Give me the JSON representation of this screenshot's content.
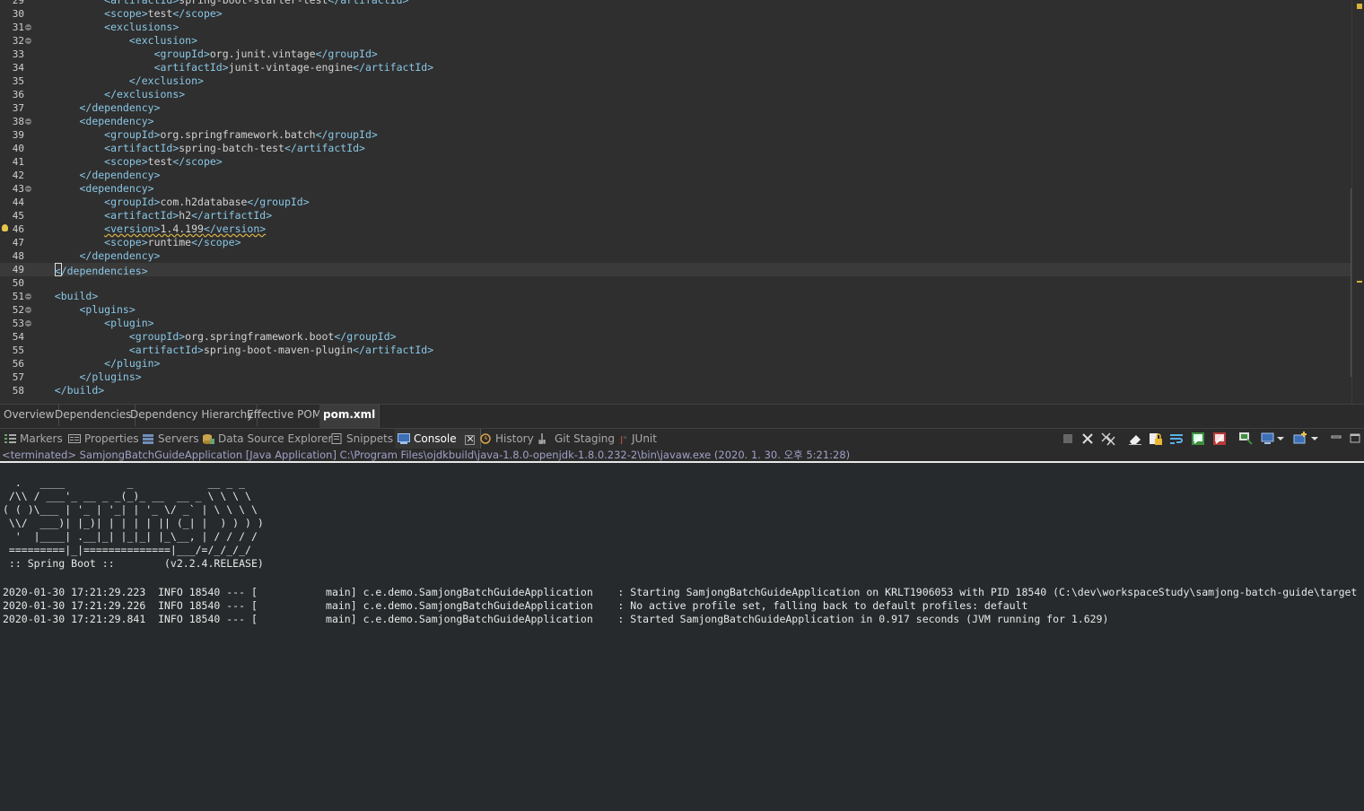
{
  "editor": {
    "lines": [
      {
        "n": "29",
        "fold": false,
        "bulb": false,
        "current": false,
        "indent": "        ",
        "open": "artifactId",
        "value": "spring-boot-starter-test",
        "close": "artifactId"
      },
      {
        "n": "30",
        "fold": false,
        "bulb": false,
        "current": false,
        "indent": "        ",
        "open": "scope",
        "value": "test",
        "close": "scope"
      },
      {
        "n": "31",
        "fold": true,
        "bulb": false,
        "current": false,
        "indent": "        ",
        "open": "exclusions",
        "value": "",
        "close": ""
      },
      {
        "n": "32",
        "fold": true,
        "bulb": false,
        "current": false,
        "indent": "            ",
        "open": "exclusion",
        "value": "",
        "close": ""
      },
      {
        "n": "33",
        "fold": false,
        "bulb": false,
        "current": false,
        "indent": "                ",
        "open": "groupId",
        "value": "org.junit.vintage",
        "close": "groupId"
      },
      {
        "n": "34",
        "fold": false,
        "bulb": false,
        "current": false,
        "indent": "                ",
        "open": "artifactId",
        "value": "junit-vintage-engine",
        "close": "artifactId"
      },
      {
        "n": "35",
        "fold": false,
        "bulb": false,
        "current": false,
        "indent": "            ",
        "open": "",
        "value": "",
        "close": "exclusion"
      },
      {
        "n": "36",
        "fold": false,
        "bulb": false,
        "current": false,
        "indent": "        ",
        "open": "",
        "value": "",
        "close": "exclusions"
      },
      {
        "n": "37",
        "fold": false,
        "bulb": false,
        "current": false,
        "indent": "    ",
        "open": "",
        "value": "",
        "close": "dependency"
      },
      {
        "n": "38",
        "fold": true,
        "bulb": false,
        "current": false,
        "indent": "    ",
        "open": "dependency",
        "value": "",
        "close": ""
      },
      {
        "n": "39",
        "fold": false,
        "bulb": false,
        "current": false,
        "indent": "        ",
        "open": "groupId",
        "value": "org.springframework.batch",
        "close": "groupId"
      },
      {
        "n": "40",
        "fold": false,
        "bulb": false,
        "current": false,
        "indent": "        ",
        "open": "artifactId",
        "value": "spring-batch-test",
        "close": "artifactId"
      },
      {
        "n": "41",
        "fold": false,
        "bulb": false,
        "current": false,
        "indent": "        ",
        "open": "scope",
        "value": "test",
        "close": "scope"
      },
      {
        "n": "42",
        "fold": false,
        "bulb": false,
        "current": false,
        "indent": "    ",
        "open": "",
        "value": "",
        "close": "dependency"
      },
      {
        "n": "43",
        "fold": true,
        "bulb": false,
        "current": false,
        "indent": "    ",
        "open": "dependency",
        "value": "",
        "close": ""
      },
      {
        "n": "44",
        "fold": false,
        "bulb": false,
        "current": false,
        "indent": "        ",
        "open": "groupId",
        "value": "com.h2database",
        "close": "groupId"
      },
      {
        "n": "45",
        "fold": false,
        "bulb": false,
        "current": false,
        "indent": "        ",
        "open": "artifactId",
        "value": "h2",
        "close": "artifactId"
      },
      {
        "n": "46",
        "fold": false,
        "bulb": true,
        "current": false,
        "warn": true,
        "indent": "        ",
        "open": "version",
        "value": "1.4.199",
        "close": "version"
      },
      {
        "n": "47",
        "fold": false,
        "bulb": false,
        "current": false,
        "indent": "        ",
        "open": "scope",
        "value": "runtime",
        "close": "scope"
      },
      {
        "n": "48",
        "fold": false,
        "bulb": false,
        "current": false,
        "indent": "    ",
        "open": "",
        "value": "",
        "close": "dependency"
      },
      {
        "n": "49",
        "fold": false,
        "bulb": false,
        "current": true,
        "caret": true,
        "indent": "",
        "open": "",
        "value": "",
        "close": "dependencies"
      },
      {
        "n": "50",
        "fold": false,
        "bulb": false,
        "current": false,
        "indent": "",
        "open": "",
        "value": "",
        "close": ""
      },
      {
        "n": "51",
        "fold": true,
        "bulb": false,
        "current": false,
        "indent": "",
        "open": "build",
        "value": "",
        "close": ""
      },
      {
        "n": "52",
        "fold": true,
        "bulb": false,
        "current": false,
        "indent": "    ",
        "open": "plugins",
        "value": "",
        "close": ""
      },
      {
        "n": "53",
        "fold": true,
        "bulb": false,
        "current": false,
        "indent": "        ",
        "open": "plugin",
        "value": "",
        "close": ""
      },
      {
        "n": "54",
        "fold": false,
        "bulb": false,
        "current": false,
        "indent": "            ",
        "open": "groupId",
        "value": "org.springframework.boot",
        "close": "groupId"
      },
      {
        "n": "55",
        "fold": false,
        "bulb": false,
        "current": false,
        "indent": "            ",
        "open": "artifactId",
        "value": "spring-boot-maven-plugin",
        "close": "artifactId"
      },
      {
        "n": "56",
        "fold": false,
        "bulb": false,
        "current": false,
        "indent": "        ",
        "open": "",
        "value": "",
        "close": "plugin"
      },
      {
        "n": "57",
        "fold": false,
        "bulb": false,
        "current": false,
        "indent": "    ",
        "open": "",
        "value": "",
        "close": "plugins"
      },
      {
        "n": "58",
        "fold": false,
        "bulb": false,
        "current": false,
        "indent": "",
        "open": "",
        "value": "",
        "close": "build"
      }
    ]
  },
  "pom_tabs": [
    "Overview",
    "Dependencies",
    "Dependency Hierarchy",
    "Effective POM",
    "pom.xml"
  ],
  "pom_active": "pom.xml",
  "view_tabs": [
    {
      "label": "Markers",
      "icon": "markers-icon"
    },
    {
      "label": "Properties",
      "icon": "properties-icon"
    },
    {
      "label": "Servers",
      "icon": "servers-icon"
    },
    {
      "label": "Data Source Explorer",
      "icon": "data-source-icon"
    },
    {
      "label": "Snippets",
      "icon": "snippets-icon"
    },
    {
      "label": "Console",
      "icon": "console-icon",
      "active": true
    },
    {
      "label": "History",
      "icon": "history-icon"
    },
    {
      "label": "Git Staging",
      "icon": "git-staging-icon"
    },
    {
      "label": "JUnit",
      "icon": "junit-icon"
    }
  ],
  "console": {
    "status": "<terminated> SamjongBatchGuideApplication [Java Application] C:\\Program Files\\ojdkbuild\\java-1.8.0-openjdk-1.8.0.232-2\\bin\\javaw.exe (2020. 1. 30. 오후 5:21:28)",
    "banner": "  .   ____          _            __ _ _\n /\\\\ / ___'_ __ _ _(_)_ __  __ _ \\ \\ \\ \\\n( ( )\\___ | '_ | '_| | '_ \\/ _` | \\ \\ \\ \\\n \\\\/  ___)| |_)| | | | | || (_| |  ) ) ) )\n  '  |____| .__|_| |_|_| |_\\__, | / / / /\n =========|_|==============|___/=/_/_/_/\n :: Spring Boot ::        (v2.2.4.RELEASE)",
    "log": [
      "2020-01-30 17:21:29.223  INFO 18540 --- [           main] c.e.demo.SamjongBatchGuideApplication    : Starting SamjongBatchGuideApplication on KRLT1906053 with PID 18540 (C:\\dev\\workspaceStudy\\samjong-batch-guide\\target",
      "2020-01-30 17:21:29.226  INFO 18540 --- [           main] c.e.demo.SamjongBatchGuideApplication    : No active profile set, falling back to default profiles: default",
      "2020-01-30 17:21:29.841  INFO 18540 --- [           main] c.e.demo.SamjongBatchGuideApplication    : Started SamjongBatchGuideApplication in 0.917 seconds (JVM running for 1.629)"
    ]
  },
  "toolbar_icons": [
    "terminate-icon",
    "remove-launch-icon",
    "remove-all-icon",
    "clear-console-icon",
    "scroll-lock-icon",
    "word-wrap-icon",
    "show-on-stdout-icon",
    "show-on-stderr-icon",
    "pin-console-icon",
    "display-console-icon",
    "open-console-icon",
    "minimize-icon",
    "maximize-icon"
  ]
}
